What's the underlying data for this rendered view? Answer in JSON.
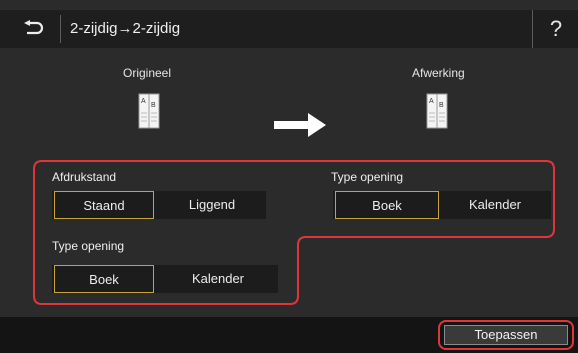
{
  "header": {
    "back_icon": "back-arrow-icon",
    "title": "2-zijdig→2-zijdig",
    "help_label": "?"
  },
  "preview": {
    "original_label": "Origineel",
    "result_label": "Afwerking",
    "doc_letter_a": "A",
    "doc_letter_b": "B",
    "arrow_icon": "right-arrow-icon"
  },
  "options": {
    "orientation": {
      "label": "Afdrukstand",
      "options": [
        "Staand",
        "Liggend"
      ],
      "selected": "Staand"
    },
    "opening_result": {
      "label": "Type opening",
      "options": [
        "Boek",
        "Kalender"
      ],
      "selected": "Boek"
    },
    "opening_original": {
      "label": "Type opening",
      "options": [
        "Boek",
        "Kalender"
      ],
      "selected": "Boek"
    }
  },
  "footer": {
    "apply_label": "Toepassen"
  },
  "colors": {
    "highlight": "#e0363b",
    "selected_border": "#c8a33a",
    "background": "#2b2b2b",
    "header": "#1e1e1e"
  }
}
